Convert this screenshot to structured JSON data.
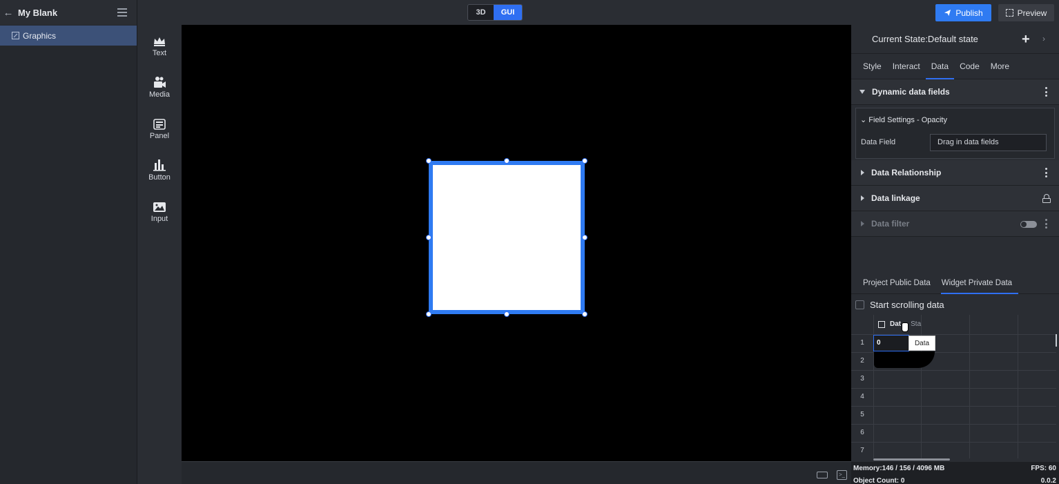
{
  "header": {
    "project_name": "My Blank",
    "mode_3d": "3D",
    "mode_gui": "GUI",
    "publish": "Publish",
    "preview": "Preview"
  },
  "layers": [
    {
      "label": "Graphics"
    }
  ],
  "toolbar": [
    {
      "label": "Text",
      "icon": "crown-icon"
    },
    {
      "label": "Media",
      "icon": "camera-icon"
    },
    {
      "label": "Panel",
      "icon": "panel-icon"
    },
    {
      "label": "Button",
      "icon": "bar-chart-icon"
    },
    {
      "label": "Input",
      "icon": "image-icon"
    }
  ],
  "panel": {
    "current_state": "Current State:Default state",
    "tabs": [
      "Style",
      "Interact",
      "Data",
      "Code",
      "More"
    ],
    "active_tab": "Data",
    "dynamic_fields": "Dynamic data fields",
    "field_settings": "Field Settings - Opacity",
    "data_field_label": "Data Field",
    "data_field_placeholder": "Drag in data fields",
    "data_relationship": "Data Relationship",
    "data_linkage": "Data linkage",
    "data_filter": "Data filter",
    "data_tabs": [
      "Project Public Data",
      "Widget Private Data"
    ],
    "start_scrolling": "Start scrolling data",
    "column_header": "Dat",
    "column_header_2": "Sta",
    "cell_value": "0",
    "tooltip": "Data",
    "row_numbers": [
      "1",
      "2",
      "3",
      "4",
      "5",
      "6",
      "7"
    ]
  },
  "status": {
    "memory": "Memory:146 / 156 / 4096 MB",
    "fps": "FPS: 60",
    "object_count": "Object Count: 0",
    "version": "0.0.2"
  },
  "colors": {
    "accent": "#2f6ff2",
    "selection": "#2f7bf2",
    "panel_bg": "#2a2d33"
  }
}
